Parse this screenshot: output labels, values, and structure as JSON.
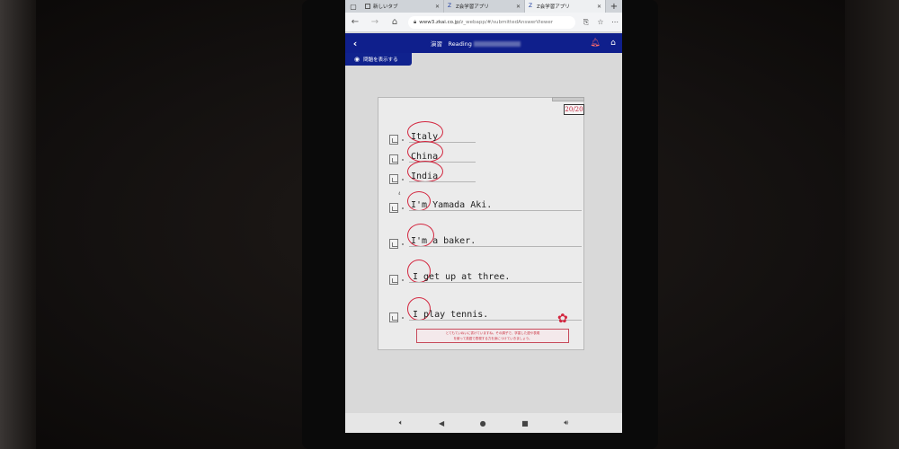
{
  "browser": {
    "tabs": [
      {
        "label": "新しいタブ",
        "active": false
      },
      {
        "label": "Z会学習アプリ",
        "active": false
      },
      {
        "label": "Z会学習アプリ",
        "active": true
      }
    ],
    "url_host": "www3.zkai.co.jp/",
    "url_path": "z_webapp/#/submittedAnswerViewer"
  },
  "app": {
    "title": "演習　Reading",
    "show_question_label": "問題を表示する"
  },
  "worksheet": {
    "score": "20/20",
    "answers": [
      {
        "text": "Italy"
      },
      {
        "text": "China"
      },
      {
        "text": "India"
      },
      {
        "text": "I'm Yamada Aki."
      },
      {
        "text": "I'm a baker."
      },
      {
        "text": "I get up at three."
      },
      {
        "text": "I play tennis."
      }
    ],
    "comment_line1": "とてもていねいに書けていますね。その調子で、学習した語や表現",
    "comment_line2": "を使って英語で表現する力を身につけていきましょう。"
  },
  "icons": {
    "accent": "#0f1f8c",
    "mark_color": "#d3263f"
  }
}
